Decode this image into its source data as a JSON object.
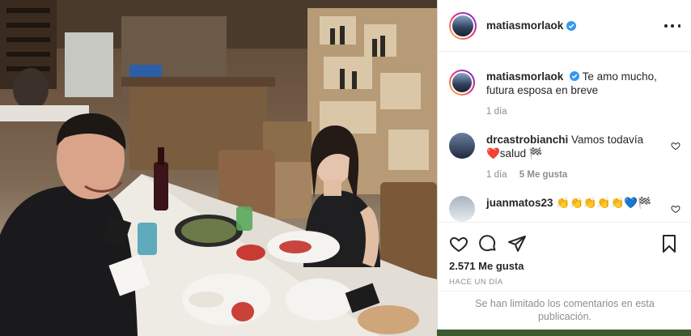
{
  "post": {
    "username": "matiasmorlaok",
    "verified": true
  },
  "caption": {
    "username": "matiasmorlaok",
    "text": "Te amo mucho, futura esposa en breve",
    "time": "1 día"
  },
  "comments": [
    {
      "username": "drcastrobianchi",
      "text": "Vamos todavía",
      "text2": "❤️salud 🏁",
      "time": "1 día",
      "likes": "5 Me gusta"
    },
    {
      "username": "juanmatos23",
      "text": "👏👏👏👏👏💙🏁"
    }
  ],
  "stats": {
    "likes": "2.571 Me gusta",
    "posted": "HACE UN DÍA"
  },
  "notice": "Se han limitado los comentarios en esta publicación.",
  "icons": [
    "more-icon",
    "heart-icon",
    "comment-icon",
    "share-icon",
    "bookmark-icon",
    "verified-icon"
  ],
  "colors": {
    "verified": "#3897f0",
    "text": "#262626",
    "muted": "#8e8e8e"
  }
}
